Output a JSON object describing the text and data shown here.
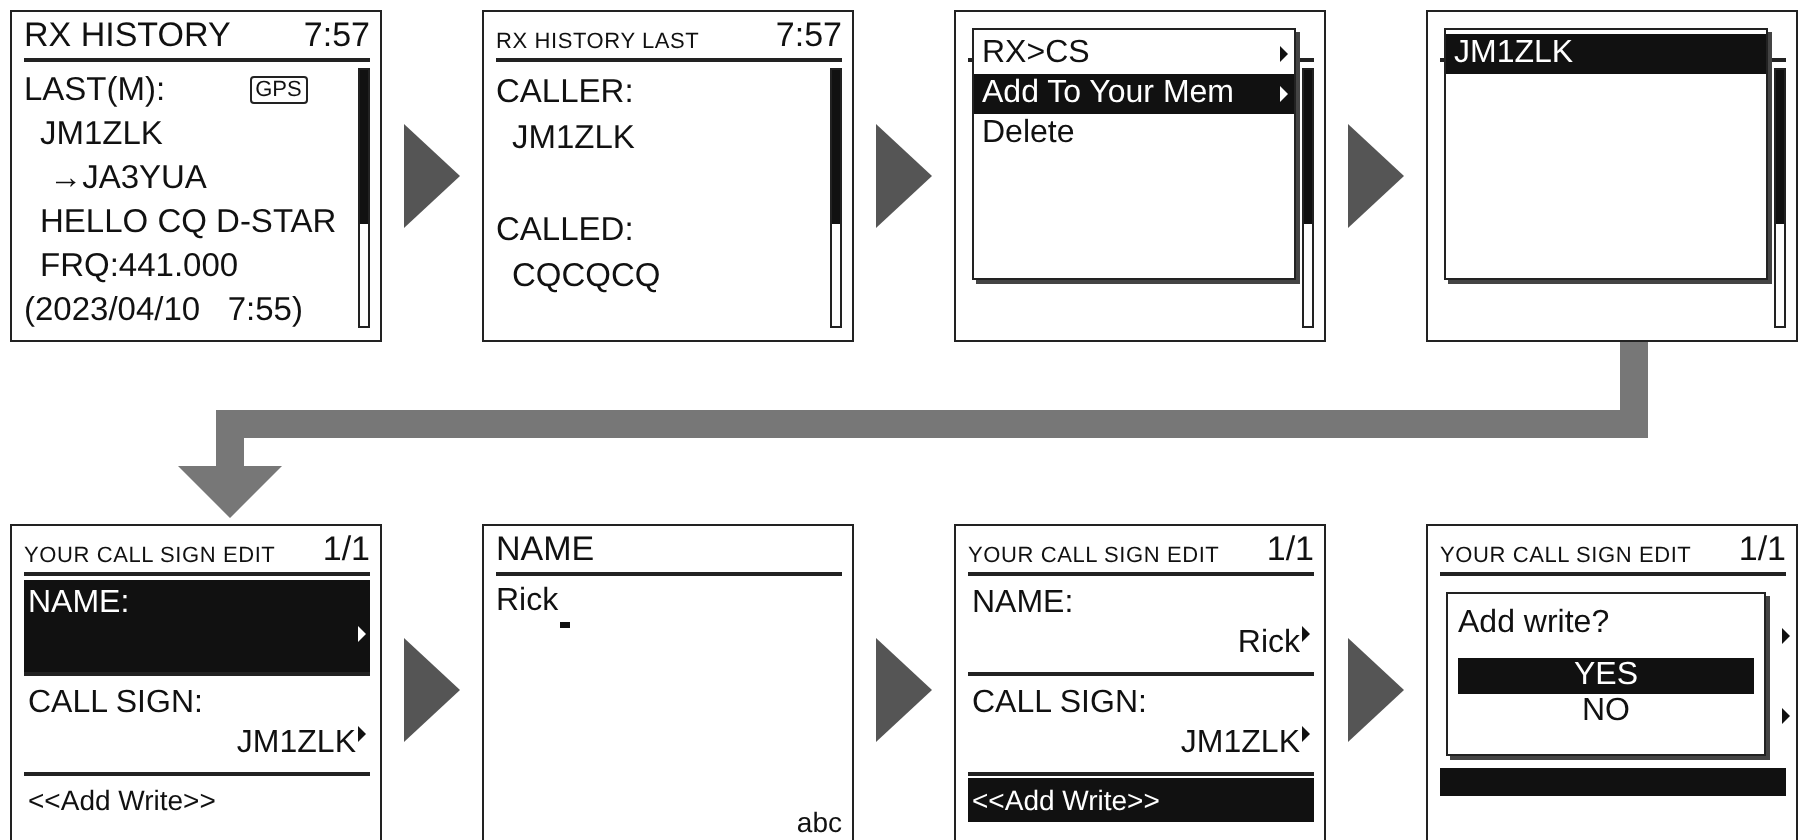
{
  "screens": [
    {
      "kind": "history",
      "title": "RX HISTORY",
      "clock": "7:57",
      "lines": [
        {
          "kind": "label",
          "text": "LAST(M):",
          "badge": "GPS"
        },
        {
          "kind": "value",
          "text": "JM1ZLK"
        },
        {
          "kind": "value",
          "text": " →JA3YUA"
        },
        {
          "kind": "value",
          "text": "HELLO CQ D-STAR"
        },
        {
          "kind": "value",
          "text": "FRQ:441.000"
        },
        {
          "kind": "label",
          "text": "(2023/04/10   7:55)"
        }
      ]
    },
    {
      "kind": "history",
      "title": "RX HISTORY LAST",
      "clock": "7:57",
      "lines": [
        {
          "kind": "label",
          "text": "CALLER:"
        },
        {
          "kind": "value",
          "text": "JM1ZLK"
        },
        {
          "kind": "spacer"
        },
        {
          "kind": "label",
          "text": "CALLED:"
        },
        {
          "kind": "value",
          "text": "CQCQCQ"
        }
      ]
    },
    {
      "kind": "popup_menu",
      "items": [
        {
          "label": "RX>CS",
          "submenu": true,
          "selected": false
        },
        {
          "label": "Add To Your Mem",
          "submenu": true,
          "selected": true
        },
        {
          "label": "Delete",
          "submenu": false,
          "selected": false
        }
      ]
    },
    {
      "kind": "popup_menu",
      "items": [
        {
          "label": "JM1ZLK",
          "submenu": false,
          "selected": true
        }
      ]
    },
    {
      "kind": "edit",
      "title": "YOUR CALL SIGN EDIT",
      "page": "1/1",
      "rows": [
        {
          "label": "NAME:",
          "submenu": true,
          "selected": true
        },
        {
          "label": "CALL SIGN:",
          "value": "JM1ZLK",
          "submenu": true,
          "selected": false
        }
      ],
      "action": {
        "label": "<<Add Write>>",
        "selected": false
      }
    },
    {
      "kind": "entry",
      "title": "NAME",
      "value": "Rick",
      "mode": "abc"
    },
    {
      "kind": "edit",
      "title": "YOUR CALL SIGN EDIT",
      "page": "1/1",
      "rows": [
        {
          "label": "NAME:",
          "value": "Rick",
          "submenu": true,
          "selected": false
        },
        {
          "label": "CALL SIGN:",
          "value": "JM1ZLK",
          "submenu": true,
          "selected": false
        }
      ],
      "action": {
        "label": "<<Add Write>>",
        "selected": true
      }
    },
    {
      "kind": "confirm",
      "title": "YOUR CALL SIGN EDIT",
      "page": "1/1",
      "question": "Add write?",
      "options": [
        {
          "label": "YES",
          "selected": true
        },
        {
          "label": "NO",
          "selected": false
        }
      ]
    }
  ]
}
